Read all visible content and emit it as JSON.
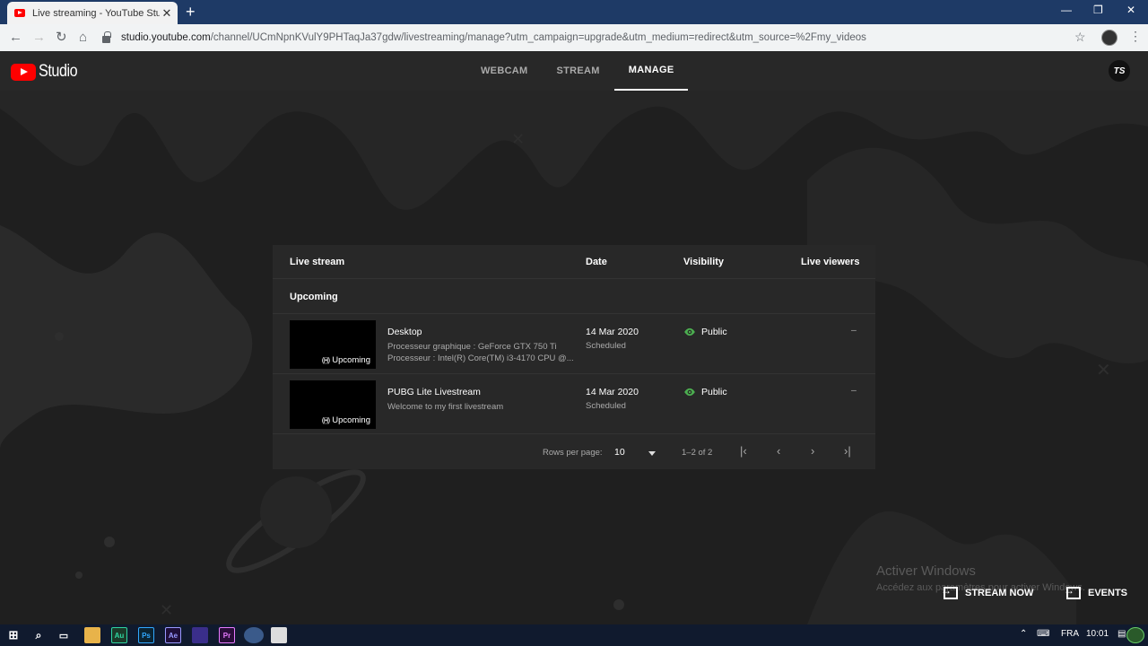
{
  "browser": {
    "tab_title": "Live streaming - YouTube Studio",
    "close_glyph": "✕",
    "newtab_glyph": "+",
    "url_host": "studio.youtube.com",
    "url_path": "/channel/UCmNpnKVulY9PHTaqJa37gdw/livestreaming/manage?utm_campaign=upgrade&utm_medium=redirect&utm_source=%2Fmy_videos"
  },
  "header": {
    "logo_text": "Studio",
    "tabs": [
      {
        "label": "WEBCAM"
      },
      {
        "label": "STREAM"
      },
      {
        "label": "MANAGE"
      }
    ],
    "avatar_text": "TS"
  },
  "table": {
    "columns": {
      "live_stream": "Live stream",
      "date": "Date",
      "visibility": "Visibility",
      "live_viewers": "Live viewers"
    },
    "section_label": "Upcoming",
    "rows": [
      {
        "thumb_badge": "Upcoming",
        "title": "Desktop",
        "desc_line1": "Processeur graphique : GeForce GTX 750 Ti",
        "desc_line2": "Processeur : Intel(R) Core(TM) i3-4170 CPU @...",
        "date": "14 Mar 2020",
        "status": "Scheduled",
        "visibility": "Public",
        "viewers": "–"
      },
      {
        "thumb_badge": "Upcoming",
        "title": "PUBG Lite Livestream",
        "desc_line1": "Welcome to my first livestream",
        "desc_line2": "",
        "date": "14 Mar 2020",
        "status": "Scheduled",
        "visibility": "Public",
        "viewers": "–"
      }
    ],
    "footer": {
      "rows_per_page_label": "Rows per page:",
      "rows_per_page_value": "10",
      "range": "1–2 of 2"
    }
  },
  "overlay": {
    "activate_title": "Activer Windows",
    "activate_sub": "Accédez aux paramètres pour activer Windows."
  },
  "actions": {
    "stream_now": "STREAM NOW",
    "events": "EVENTS"
  },
  "taskbar": {
    "apps": [
      "Au",
      "Ps",
      "Ae",
      "Pr"
    ],
    "lang": "FRA",
    "time": "10:01"
  },
  "colors": {
    "accent_green": "#4caf50",
    "youtube_red": "#ff0000",
    "page_bg": "#1f1f1f",
    "card_bg": "#282828"
  }
}
